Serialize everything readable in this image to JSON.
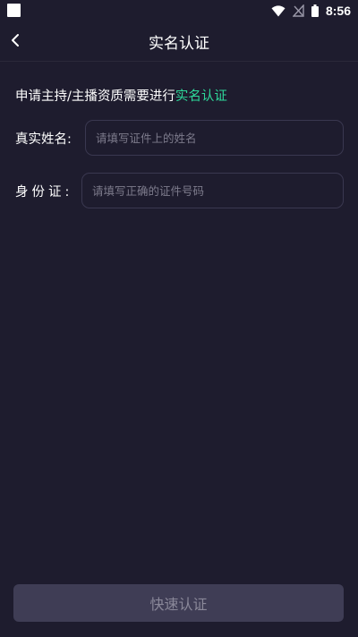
{
  "status_bar": {
    "time": "8:56",
    "icons": [
      "notification-square-icon",
      "wifi-icon",
      "no-signal-icon",
      "battery-icon"
    ]
  },
  "header": {
    "title": "实名认证",
    "back_icon": "chevron-left-icon"
  },
  "notice": {
    "text": "申请主持/主播资质需要进行",
    "highlight": "实名认证"
  },
  "form": {
    "name": {
      "label": "真实姓名:",
      "value": "",
      "placeholder": "请填写证件上的姓名"
    },
    "id_card": {
      "label": "身份证:",
      "value": "",
      "placeholder": "请填写正确的证件号码"
    }
  },
  "submit": {
    "label": "快速认证"
  },
  "colors": {
    "background": "#1e1c2e",
    "accent": "#2ed99a",
    "input_border": "#3a3850",
    "button_bg": "#3f3d55",
    "button_text": "#8a8899"
  }
}
